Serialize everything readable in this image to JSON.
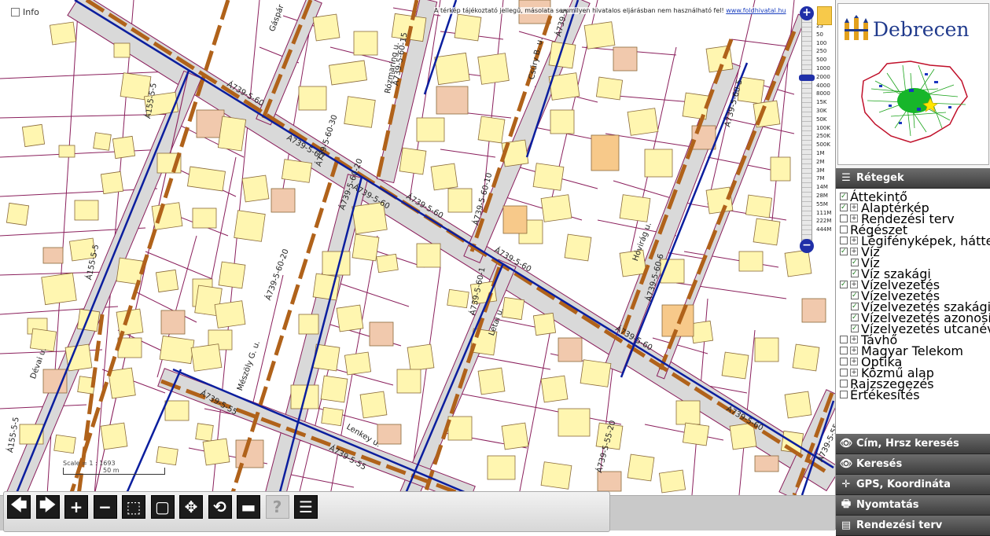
{
  "map": {
    "info_label": "Info",
    "disclaimer_text": "A térkép tájékoztató jellegű, másolata semmilyen hivatalos eljárásban nem használható fel!",
    "disclaimer_link": "www.foldhivatal.hu",
    "scale_text": "Scale = 1 : 1693",
    "scale_bar_label": "50 m",
    "zoom_in": "+",
    "zoom_out": "−",
    "zoom_scales": [
      "25",
      "50",
      "100",
      "250",
      "500",
      "1000",
      "2000",
      "4000",
      "8000",
      "15K",
      "30K",
      "50K",
      "100K",
      "250K",
      "500K",
      "1M",
      "2M",
      "3M",
      "7M",
      "14M",
      "28M",
      "55M",
      "111M",
      "222M",
      "444M"
    ],
    "street_labels": [
      "Á739-5-60",
      "Á739-5-60",
      "Á739-5-60",
      "Á739-5-60",
      "Á739-5-60",
      "Á739-5-60",
      "Á739-5-60",
      "Á739-5-60-15",
      "Rózmaring u.",
      "Gáspár",
      "Csűry B. u.",
      "Á739-5",
      "Á739-5-60-5",
      "Á739-5-60-10",
      "Á739-5-60-1",
      "Á739-5-60-20",
      "Á739-5-60-30",
      "Á739-5-60-20",
      "Á155-5-5",
      "Á155-5-5",
      "Á155-5-5",
      "Dévai u.",
      "Mészöly G. u.",
      "Hóvirág u.",
      "Létai u.",
      "Lenkey u.",
      "Á739-5-55",
      "Á739-5-55",
      "Á739-5-55-20",
      "Á739-5-60-6",
      "Á739-5-55"
    ]
  },
  "toolbar": {
    "buttons": [
      {
        "name": "back",
        "glyph": "🡄"
      },
      {
        "name": "forward",
        "glyph": "🡆"
      },
      {
        "name": "zoom-in",
        "glyph": "+"
      },
      {
        "name": "zoom-out",
        "glyph": "−"
      },
      {
        "name": "zoom-box",
        "glyph": "⬚"
      },
      {
        "name": "full-extent",
        "glyph": "▢"
      },
      {
        "name": "pan",
        "glyph": "✥"
      },
      {
        "name": "refresh",
        "glyph": "⟲"
      },
      {
        "name": "measure",
        "glyph": "▬"
      },
      {
        "name": "help",
        "glyph": "?"
      },
      {
        "name": "document",
        "glyph": "☰"
      }
    ]
  },
  "sidebar": {
    "logo_title": "Debrecen",
    "layers_title": "Rétegek",
    "layers": [
      {
        "label": "Áttekintő",
        "checked": true,
        "indent": 0,
        "expander": false
      },
      {
        "label": "Alaptérkép",
        "checked": true,
        "indent": 0,
        "expander": true
      },
      {
        "label": "Rendezési terv",
        "checked": false,
        "indent": 0,
        "expander": true
      },
      {
        "label": "Régészet",
        "checked": false,
        "indent": 0,
        "expander": false
      },
      {
        "label": "Légifényképek, hátterek",
        "checked": false,
        "indent": 0,
        "expander": true
      },
      {
        "label": "Víz",
        "checked": true,
        "indent": 0,
        "expander": true
      },
      {
        "label": "Víz",
        "checked": true,
        "indent": 1,
        "expander": false
      },
      {
        "label": "Víz szakági",
        "checked": true,
        "indent": 1,
        "expander": false
      },
      {
        "label": "Vízelvezetés",
        "checked": true,
        "indent": 0,
        "expander": true
      },
      {
        "label": "Vízelvezetés",
        "checked": true,
        "indent": 1,
        "expander": false
      },
      {
        "label": "Vízelvezetés szakági",
        "checked": true,
        "indent": 1,
        "expander": false
      },
      {
        "label": "Vízelvezetés azonosító",
        "checked": true,
        "indent": 1,
        "expander": false
      },
      {
        "label": "Vízelvezetés utcanév",
        "checked": true,
        "indent": 1,
        "expander": false
      },
      {
        "label": "Távhő",
        "checked": false,
        "indent": 0,
        "expander": true
      },
      {
        "label": "Magyar Telekom",
        "checked": false,
        "indent": 0,
        "expander": true
      },
      {
        "label": "Optika",
        "checked": false,
        "indent": 0,
        "expander": true
      },
      {
        "label": "Közmű alap",
        "checked": false,
        "indent": 0,
        "expander": true
      },
      {
        "label": "Rajzszegezés",
        "checked": false,
        "indent": 0,
        "expander": false
      },
      {
        "label": "Értékesítés",
        "checked": false,
        "indent": 0,
        "expander": false
      }
    ],
    "bottom_sections": [
      {
        "label": "Cím, Hrsz keresés",
        "icon": "eye-icon"
      },
      {
        "label": "Keresés",
        "icon": "eye-icon"
      },
      {
        "label": "GPS, Koordináta",
        "icon": "crosshair-icon"
      },
      {
        "label": "Nyomtatás",
        "icon": "printer-icon"
      },
      {
        "label": "Rendezési terv",
        "icon": "document-icon"
      }
    ]
  },
  "colors": {
    "parcel_line": "#8a1f5c",
    "road_fill": "#d9d9d9",
    "water_pipe": "#0b1e9e",
    "drain_pipe": "#b0621a",
    "building": "#fff6b0",
    "building_other": "#f1c9ad"
  }
}
